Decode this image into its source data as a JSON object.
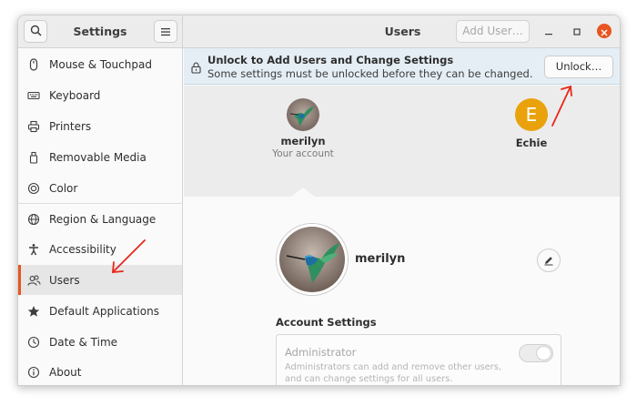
{
  "sidebar_header": {
    "title": "Settings"
  },
  "header": {
    "title": "Users",
    "add_user_label": "Add User…"
  },
  "sidebar": {
    "items": [
      {
        "label": "Mouse & Touchpad",
        "icon": "mouse-icon"
      },
      {
        "label": "Keyboard",
        "icon": "keyboard-icon"
      },
      {
        "label": "Printers",
        "icon": "printer-icon"
      },
      {
        "label": "Removable Media",
        "icon": "removable-media-icon"
      },
      {
        "label": "Color",
        "icon": "color-icon"
      },
      {
        "label": "Region & Language",
        "icon": "globe-icon"
      },
      {
        "label": "Accessibility",
        "icon": "accessibility-icon"
      },
      {
        "label": "Users",
        "icon": "users-icon",
        "active": true
      },
      {
        "label": "Default Applications",
        "icon": "star-icon"
      },
      {
        "label": "Date & Time",
        "icon": "clock-icon"
      },
      {
        "label": "About",
        "icon": "info-icon"
      }
    ]
  },
  "infobar": {
    "title": "Unlock to Add Users and Change Settings",
    "subtitle": "Some settings must be unlocked before they can be changed.",
    "unlock_label": "Unlock…"
  },
  "users": [
    {
      "name": "merilyn",
      "role": "Your account"
    },
    {
      "name": "Echie",
      "initial": "E"
    }
  ],
  "profile": {
    "name": "merilyn"
  },
  "account_settings": {
    "section_title": "Account Settings",
    "administrator_label": "Administrator",
    "administrator_description": "Administrators can add and remove other users, and can change settings for all users.",
    "administrator_enabled": false
  },
  "colors": {
    "accent": "#e95420",
    "avatar_e": "#e9a20b",
    "infobar": "#e4eef4",
    "annotation_arrow": "#e8261a"
  }
}
